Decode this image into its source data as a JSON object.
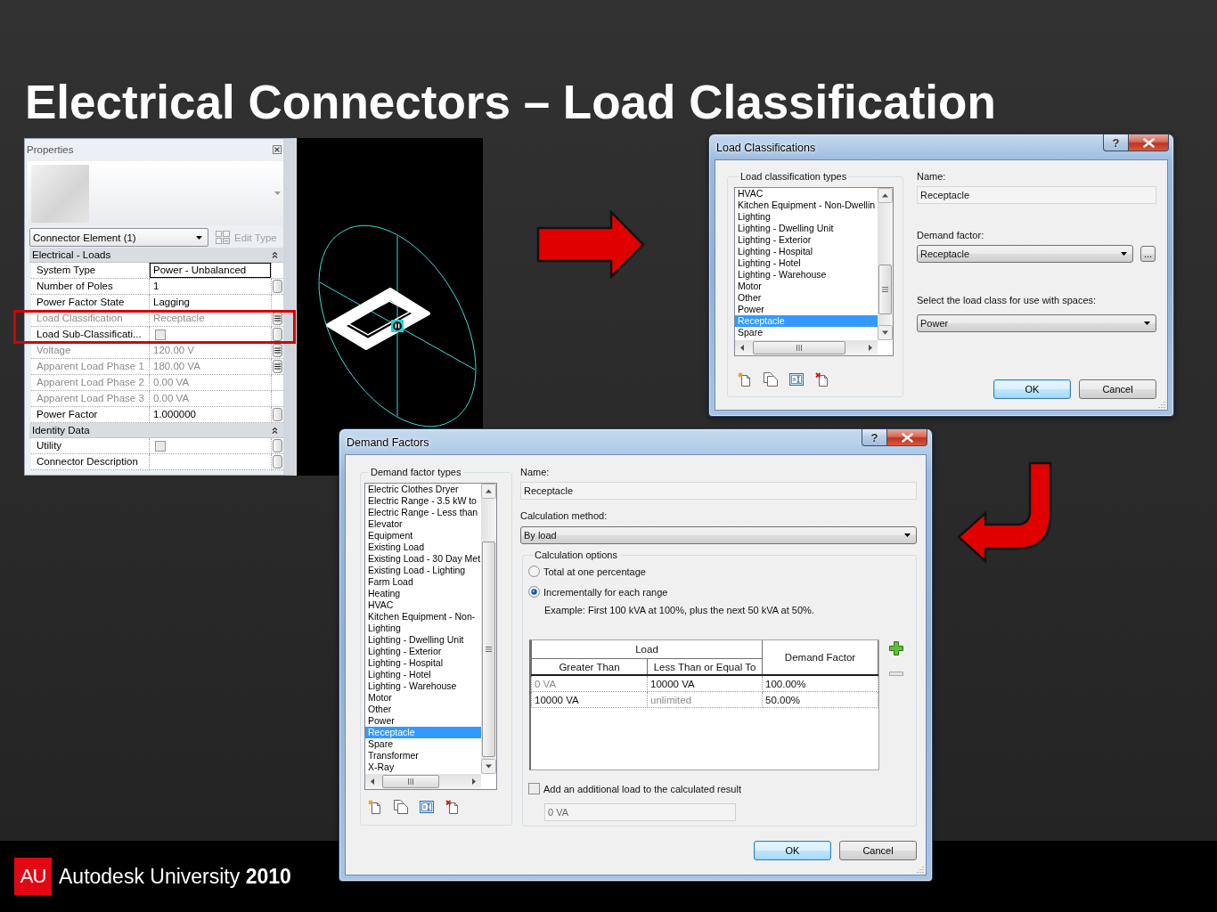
{
  "slide": {
    "title": "Electrical Connectors – Load Classification"
  },
  "properties": {
    "title": "Properties",
    "type_selector": "Connector Element (1)",
    "edit_type": {
      "label": "Edit Type",
      "disabled": true
    },
    "groups": [
      {
        "name": "Electrical - Loads",
        "expanded": true,
        "rows": [
          {
            "label": "System Type",
            "kind": "text",
            "value": "Power - Unbalanced",
            "disabled": false,
            "selected": true,
            "highlighted": false
          },
          {
            "label": "Number of Poles",
            "kind": "text",
            "value": "1",
            "disabled": false,
            "selected": false,
            "highlighted": false,
            "param_button": {
              "linked": false
            }
          },
          {
            "label": "Power Factor State",
            "kind": "text",
            "value": "Lagging",
            "disabled": false,
            "selected": false,
            "highlighted": false
          },
          {
            "label": "Load Classification",
            "kind": "text",
            "value": "Receptacle",
            "disabled": true,
            "selected": false,
            "highlighted": true,
            "param_button": {
              "linked": true
            }
          },
          {
            "label": "Load Sub-Classificati...",
            "kind": "checkbox",
            "checked": false,
            "disabled": false,
            "selected": false,
            "highlighted": true,
            "param_button": {
              "linked": false
            }
          },
          {
            "label": "Voltage",
            "kind": "text",
            "value": "120.00 V",
            "disabled": true,
            "selected": false,
            "highlighted": false,
            "param_button": {
              "linked": true
            }
          },
          {
            "label": "Apparent Load Phase 1",
            "kind": "text",
            "value": "180.00 VA",
            "disabled": true,
            "selected": false,
            "highlighted": false,
            "param_button": {
              "linked": true
            }
          },
          {
            "label": "Apparent Load Phase 2",
            "kind": "text",
            "value": "0.00 VA",
            "disabled": true,
            "selected": false,
            "highlighted": false
          },
          {
            "label": "Apparent Load Phase 3",
            "kind": "text",
            "value": "0.00 VA",
            "disabled": true,
            "selected": false,
            "highlighted": false
          },
          {
            "label": "Power Factor",
            "kind": "text",
            "value": "1.000000",
            "disabled": false,
            "selected": false,
            "highlighted": false,
            "param_button": {
              "linked": false
            }
          }
        ]
      },
      {
        "name": "Identity Data",
        "expanded": true,
        "rows": [
          {
            "label": "Utility",
            "kind": "checkbox",
            "checked": false,
            "disabled": false,
            "selected": false,
            "highlighted": false,
            "param_button": {
              "linked": false
            }
          },
          {
            "label": "Connector Description",
            "kind": "text",
            "disabled": false,
            "selected": false,
            "highlighted": false,
            "param_button": {
              "linked": false
            }
          }
        ]
      }
    ]
  },
  "load_classifications": {
    "title": "Load Classifications",
    "help": "?",
    "types_label": "Load classification types",
    "types": [
      {
        "label": "HVAC",
        "selected": false
      },
      {
        "label": "Kitchen Equipment - Non-Dwellin",
        "selected": false
      },
      {
        "label": "Lighting",
        "selected": false
      },
      {
        "label": "Lighting - Dwelling Unit",
        "selected": false
      },
      {
        "label": "Lighting - Exterior",
        "selected": false
      },
      {
        "label": "Lighting - Hospital",
        "selected": false
      },
      {
        "label": "Lighting - Hotel",
        "selected": false
      },
      {
        "label": "Lighting - Warehouse",
        "selected": false
      },
      {
        "label": "Motor",
        "selected": false
      },
      {
        "label": "Other",
        "selected": false
      },
      {
        "label": "Power",
        "selected": false
      },
      {
        "label": "Receptacle",
        "selected": true
      },
      {
        "label": "Spare",
        "selected": false
      }
    ],
    "name_label": "Name:",
    "name": "Receptacle",
    "demand_factor_label": "Demand factor:",
    "demand_factor": "Receptacle",
    "browse": "...",
    "space_class_label": "Select the load class for use with spaces:",
    "space_class": "Power",
    "buttons": [
      {
        "label": "OK",
        "default": true
      },
      {
        "label": "Cancel",
        "default": false
      }
    ]
  },
  "demand_factors": {
    "title": "Demand Factors",
    "help": "?",
    "types_label": "Demand factor types",
    "types": [
      {
        "label": "Electric Clothes Dryer",
        "selected": false
      },
      {
        "label": "Electric Range - 3.5 kW to",
        "selected": false
      },
      {
        "label": "Electric Range - Less than",
        "selected": false
      },
      {
        "label": "Elevator",
        "selected": false
      },
      {
        "label": "Equipment",
        "selected": false
      },
      {
        "label": "Existing Load",
        "selected": false
      },
      {
        "label": "Existing Load - 30 Day Met",
        "selected": false
      },
      {
        "label": "Existing Load - Lighting",
        "selected": false
      },
      {
        "label": "Farm Load",
        "selected": false
      },
      {
        "label": "Heating",
        "selected": false
      },
      {
        "label": "HVAC",
        "selected": false
      },
      {
        "label": "Kitchen Equipment - Non-",
        "selected": false
      },
      {
        "label": "Lighting",
        "selected": false
      },
      {
        "label": "Lighting - Dwelling Unit",
        "selected": false
      },
      {
        "label": "Lighting - Exterior",
        "selected": false
      },
      {
        "label": "Lighting - Hospital",
        "selected": false
      },
      {
        "label": "Lighting - Hotel",
        "selected": false
      },
      {
        "label": "Lighting - Warehouse",
        "selected": false
      },
      {
        "label": "Motor",
        "selected": false
      },
      {
        "label": "Other",
        "selected": false
      },
      {
        "label": "Power",
        "selected": false
      },
      {
        "label": "Receptacle",
        "selected": true
      },
      {
        "label": "Spare",
        "selected": false
      },
      {
        "label": "Transformer",
        "selected": false
      },
      {
        "label": "X-Ray",
        "selected": false
      }
    ],
    "name_label": "Name:",
    "name": "Receptacle",
    "method_label": "Calculation method:",
    "method": "By load",
    "options_label": "Calculation options",
    "options": [
      {
        "label": "Total at one percentage",
        "selected": false
      },
      {
        "label": "Incrementally for each range",
        "selected": true
      }
    ],
    "example": "Example: First 100 kVA at 100%, plus the next 50 kVA at 50%.",
    "table": {
      "group_header": "Load",
      "columns": [
        "Greater Than",
        "Less Than or Equal To"
      ],
      "factor_header": "Demand Factor",
      "rows": [
        [
          {
            "text": "0 VA",
            "disabled": true
          },
          {
            "text": "10000 VA",
            "disabled": false
          },
          {
            "text": "100.00%",
            "disabled": false
          }
        ],
        [
          {
            "text": "10000 VA",
            "disabled": false
          },
          {
            "text": "unlimited",
            "disabled": true
          },
          {
            "text": "50.00%",
            "disabled": false
          }
        ]
      ]
    },
    "row_buttons": [
      {
        "kind": "add",
        "disabled": false
      },
      {
        "kind": "remove",
        "disabled": true
      }
    ],
    "additional_load": {
      "label": "Add an additional load to the calculated result",
      "checked": false,
      "value": "0 VA"
    },
    "buttons": [
      {
        "label": "OK",
        "default": true
      },
      {
        "label": "Cancel",
        "default": false
      }
    ]
  },
  "footer": {
    "logo": "AU",
    "text": "Autodesk University **2010**"
  }
}
